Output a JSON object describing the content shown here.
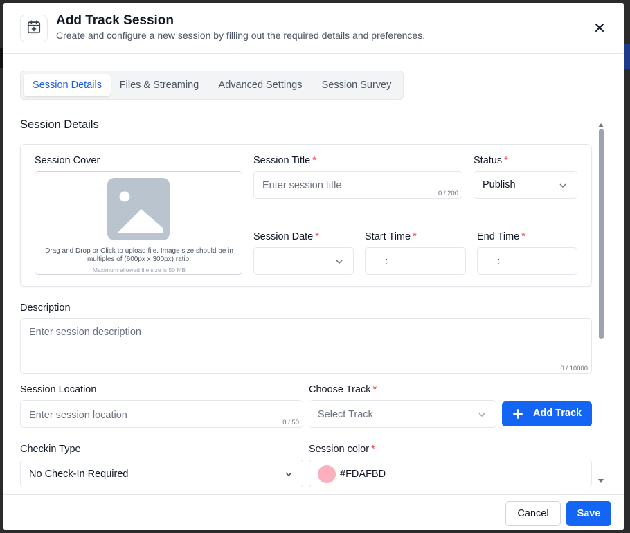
{
  "modal": {
    "title": "Add Track Session",
    "subtitle": "Create and configure a new session by filling out the required details and preferences.",
    "header_icon": "calendar-plus-icon",
    "close_icon": "close-icon"
  },
  "tabs": [
    {
      "label": "Session Details",
      "active": true
    },
    {
      "label": "Files & Streaming",
      "active": false
    },
    {
      "label": "Advanced Settings",
      "active": false
    },
    {
      "label": "Session Survey",
      "active": false
    }
  ],
  "section_title": "Session Details",
  "cover": {
    "label": "Session Cover",
    "icon": "image-placeholder-icon",
    "help_text": "Drag and Drop or Click to upload file. Image size should be in multiples of (600px x 300px) ratio.",
    "max_size_text": "Maximum allowed file size is 50 MB"
  },
  "session_title": {
    "label": "Session Title",
    "required_mark": "*",
    "placeholder": "Enter session title",
    "counter": "0 / 200"
  },
  "status": {
    "label": "Status",
    "required_mark": "*",
    "value": "Publish"
  },
  "session_date": {
    "label": "Session Date",
    "required_mark": "*",
    "value": ""
  },
  "start_time": {
    "label": "Start Time",
    "required_mark": "*",
    "value": "__:__"
  },
  "end_time": {
    "label": "End Time",
    "required_mark": "*",
    "value": "__:__"
  },
  "description": {
    "label": "Description",
    "placeholder": "Enter session description",
    "counter": "0 / 10000"
  },
  "location": {
    "label": "Session Location",
    "placeholder": "Enter session location",
    "counter": "0 / 50"
  },
  "track": {
    "label": "Choose Track",
    "required_mark": "*",
    "placeholder": "Select Track",
    "add_button": "Add Track",
    "add_icon": "plus-icon"
  },
  "checkin": {
    "label": "Checkin Type",
    "value": "No Check-In Required"
  },
  "session_color": {
    "label": "Session color",
    "required_mark": "*",
    "value": "#FDAFBD",
    "swatch_color": "#FDAFBD"
  },
  "footer": {
    "cancel": "Cancel",
    "save": "Save"
  },
  "colors": {
    "primary": "#1565F5",
    "required": "#EF4444",
    "active_tab": "#1D5FDC"
  }
}
